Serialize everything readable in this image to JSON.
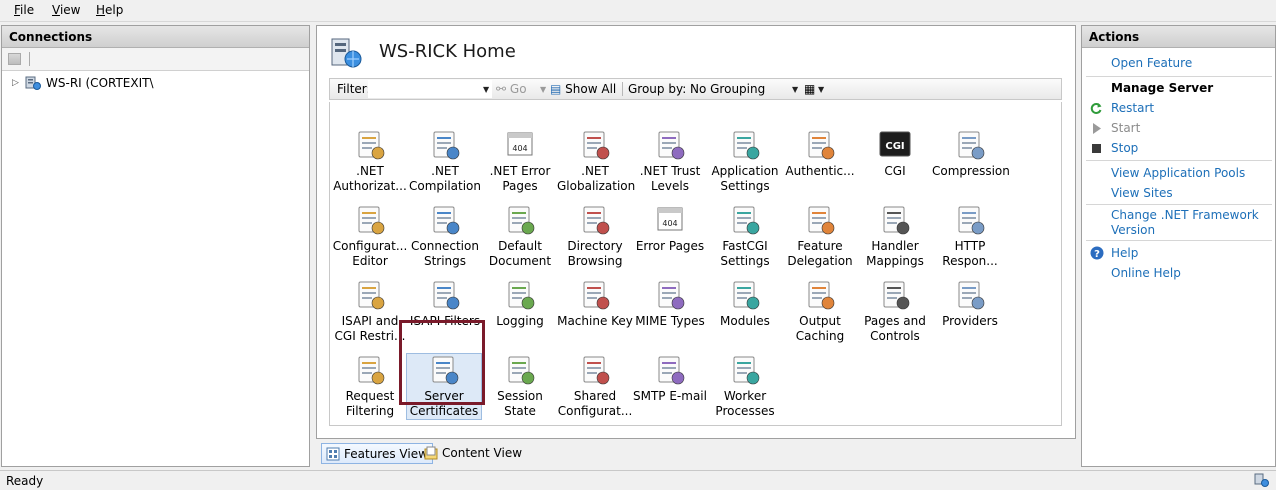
{
  "menu": {
    "file": "File",
    "view": "View",
    "help": "Help"
  },
  "connections": {
    "title": "Connections",
    "tree": {
      "server_label": "WS-RI (CORTEXIT\\"
    }
  },
  "center": {
    "title": "WS-RICK Home",
    "filterbar": {
      "filter_label": "Filter:",
      "filter_value": "",
      "go_label": "Go",
      "show_all_label": "Show All",
      "group_by_label": "Group by:",
      "group_by_value": "No Grouping"
    },
    "features": [
      {
        "label": ".NET\nAuthorizat...",
        "icon": "net-authorization-icon"
      },
      {
        "label": ".NET\nCompilation",
        "icon": "net-compilation-icon"
      },
      {
        "label": ".NET Error\nPages",
        "icon": "net-error-pages-icon"
      },
      {
        "label": ".NET\nGlobalization",
        "icon": "net-globalization-icon"
      },
      {
        "label": ".NET Trust\nLevels",
        "icon": "net-trust-levels-icon"
      },
      {
        "label": "Application\nSettings",
        "icon": "application-settings-icon"
      },
      {
        "label": "Authentic...",
        "icon": "authentication-icon"
      },
      {
        "label": "CGI",
        "icon": "cgi-icon"
      },
      {
        "label": "Compression",
        "icon": "compression-icon"
      },
      {
        "label": "Configurat...\nEditor",
        "icon": "configuration-editor-icon"
      },
      {
        "label": "Connection\nStrings",
        "icon": "connection-strings-icon"
      },
      {
        "label": "Default\nDocument",
        "icon": "default-document-icon"
      },
      {
        "label": "Directory\nBrowsing",
        "icon": "directory-browsing-icon"
      },
      {
        "label": "Error Pages",
        "icon": "error-pages-icon"
      },
      {
        "label": "FastCGI\nSettings",
        "icon": "fastcgi-settings-icon"
      },
      {
        "label": "Feature\nDelegation",
        "icon": "feature-delegation-icon"
      },
      {
        "label": "Handler\nMappings",
        "icon": "handler-mappings-icon"
      },
      {
        "label": "HTTP\nRespon...",
        "icon": "http-response-icon"
      },
      {
        "label": "ISAPI and\nCGI Restri...",
        "icon": "isapi-cgi-restrictions-icon"
      },
      {
        "label": "ISAPI Filters",
        "icon": "isapi-filters-icon"
      },
      {
        "label": "Logging",
        "icon": "logging-icon"
      },
      {
        "label": "Machine Key",
        "icon": "machine-key-icon"
      },
      {
        "label": "MIME Types",
        "icon": "mime-types-icon"
      },
      {
        "label": "Modules",
        "icon": "modules-icon"
      },
      {
        "label": "Output\nCaching",
        "icon": "output-caching-icon"
      },
      {
        "label": "Pages and\nControls",
        "icon": "pages-controls-icon"
      },
      {
        "label": "Providers",
        "icon": "providers-icon"
      },
      {
        "label": "Request\nFiltering",
        "icon": "request-filtering-icon"
      },
      {
        "label": "Server\nCertificates",
        "icon": "server-certificates-icon"
      },
      {
        "label": "Session State",
        "icon": "session-state-icon"
      },
      {
        "label": "Shared\nConfigurat...",
        "icon": "shared-configuration-icon"
      },
      {
        "label": "SMTP E-mail",
        "icon": "smtp-email-icon"
      },
      {
        "label": "Worker\nProcesses",
        "icon": "worker-processes-icon"
      }
    ],
    "selected_feature": "Server Certificates"
  },
  "view_tabs": {
    "features_view": "Features View",
    "content_view": "Content View"
  },
  "actions": {
    "title": "Actions",
    "open_feature": "Open Feature",
    "manage_server_heading": "Manage Server",
    "restart": "Restart",
    "start": "Start",
    "stop": "Stop",
    "view_app_pools": "View Application Pools",
    "view_sites": "View Sites",
    "change_framework": "Change .NET Framework\nVersion",
    "help": "Help",
    "online_help": "Online Help"
  },
  "status": {
    "text": "Ready"
  },
  "colors": {
    "accent": "#1d6fb8",
    "highlight_border": "#7a1a2a",
    "disabled": "#8c8c8c"
  }
}
